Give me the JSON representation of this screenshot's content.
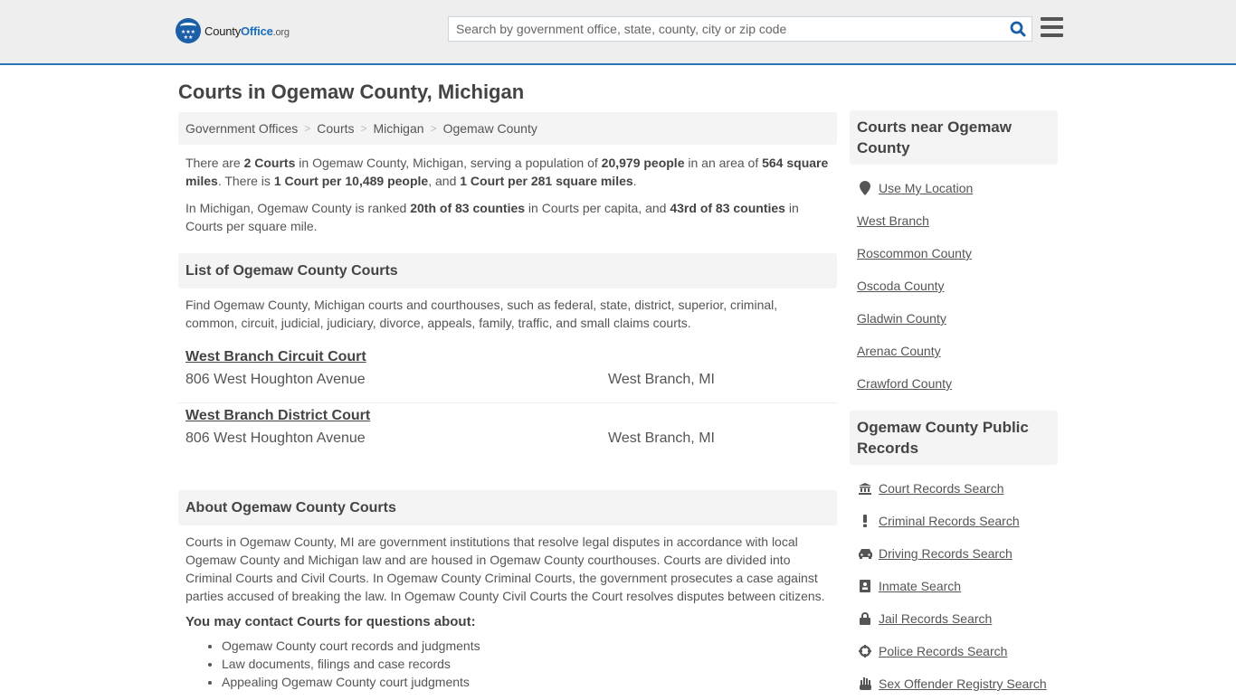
{
  "header": {
    "logo": {
      "county": "County",
      "office": "Office",
      "org": ".org",
      "stars": "★★★ ★★"
    },
    "search": {
      "placeholder": "Search by government office, state, county, city or zip code",
      "value": ""
    },
    "accent_color": "#2b74b5"
  },
  "page": {
    "title": "Courts in Ogemaw County, Michigan"
  },
  "breadcrumb": [
    {
      "label": "Government Offices"
    },
    {
      "label": "Courts"
    },
    {
      "label": "Michigan"
    },
    {
      "label": "Ogemaw County"
    }
  ],
  "intro": {
    "p1": {
      "a": "There are ",
      "b1": "2 Courts",
      "c": " in Ogemaw County, Michigan, serving a population of ",
      "b2": "20,979 people",
      "d": " in an area of ",
      "b3": "564 square miles",
      "e": ". There is ",
      "b4": "1 Court per 10,489 people",
      "f": ", and ",
      "b5": "1 Court per 281 square miles",
      "g": "."
    },
    "p2": {
      "a": "In Michigan, Ogemaw County is ranked ",
      "b1": "20th of 83 counties",
      "c": " in Courts per capita, and ",
      "b2": "43rd of 83 counties",
      "d": " in Courts per square mile."
    }
  },
  "list_section": {
    "heading": "List of Ogemaw County Courts",
    "description": "Find Ogemaw County, Michigan courts and courthouses, such as federal, state, district, superior, criminal, common, circuit, judicial, judiciary, divorce, appeals, family, traffic, and small claims courts.",
    "courts": [
      {
        "name": "West Branch Circuit Court",
        "address": "806 West Houghton Avenue",
        "city": "West Branch, MI"
      },
      {
        "name": "West Branch District Court",
        "address": "806 West Houghton Avenue",
        "city": "West Branch, MI"
      }
    ]
  },
  "about_section": {
    "heading": "About Ogemaw County Courts",
    "body": "Courts in Ogemaw County, MI are government institutions that resolve legal disputes in accordance with local Ogemaw County and Michigan law and are housed in Ogemaw County courthouses. Courts are divided into Criminal Courts and Civil Courts. In Ogemaw County Criminal Courts, the government prosecutes a case against parties accused of breaking the law. In Ogemaw County Civil Courts the Court resolves disputes between citizens.",
    "contact_heading": "You may contact Courts for questions about:",
    "bullets": [
      "Ogemaw County court records and judgments",
      "Law documents, filings and case records",
      "Appealing Ogemaw County court judgments"
    ]
  },
  "sidebar": {
    "nearby": {
      "heading": "Courts near Ogemaw County",
      "use_location": "Use My Location",
      "links": [
        "West Branch",
        "Roscommon County",
        "Oscoda County",
        "Gladwin County",
        "Arenac County",
        "Crawford County"
      ]
    },
    "records": {
      "heading": "Ogemaw County Public Records",
      "links": [
        {
          "label": "Court Records Search",
          "icon": "🏛"
        },
        {
          "label": "Criminal Records Search",
          "icon": "!"
        },
        {
          "label": "Driving Records Search",
          "icon": "🚘"
        },
        {
          "label": "Inmate Search",
          "icon": "▣"
        },
        {
          "label": "Jail Records Search",
          "icon": "🔒"
        },
        {
          "label": "Police Records Search",
          "icon": "⊕"
        },
        {
          "label": "Sex Offender Registry Search",
          "icon": "✋"
        }
      ]
    }
  }
}
